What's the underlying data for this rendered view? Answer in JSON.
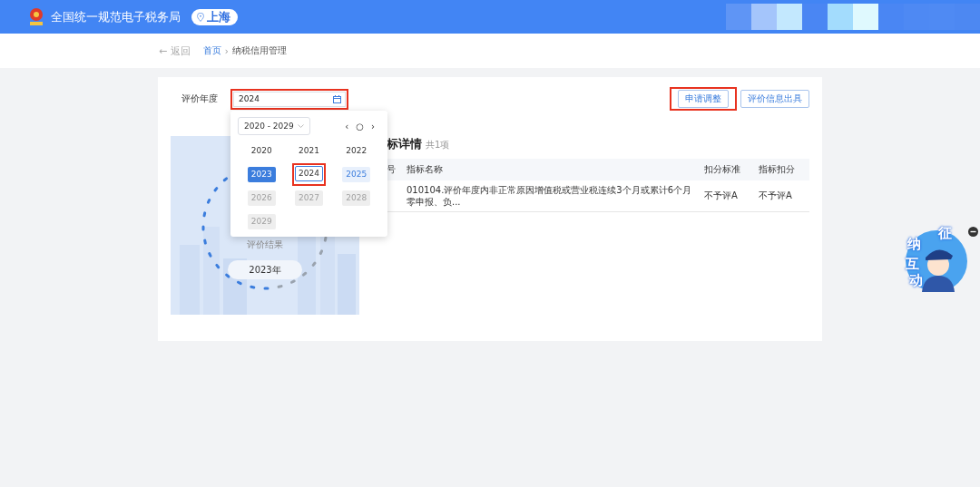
{
  "header": {
    "title": "全国统一规范电子税务局",
    "location": "上海"
  },
  "breadcrumb": {
    "back": "← 返回",
    "items": [
      {
        "label": "首页",
        "link": true
      },
      {
        "label": "纳税信用管理",
        "link": false
      }
    ],
    "separator": "›"
  },
  "filter": {
    "label": "评价年度",
    "value": "2024",
    "highlighted": true
  },
  "actions": [
    {
      "label": "申请调整",
      "highlighted": true
    },
    {
      "label": "评价信息出具",
      "highlighted": false
    }
  ],
  "year_picker": {
    "decade": "2020 - 2029",
    "nav": [
      "‹",
      "○",
      "›"
    ],
    "years": [
      {
        "label": "2020",
        "selected": false,
        "current": false,
        "in_range": false,
        "disabled": false,
        "highlighted": false
      },
      {
        "label": "2021",
        "selected": false,
        "current": false,
        "in_range": false,
        "disabled": false,
        "highlighted": false
      },
      {
        "label": "2022",
        "selected": false,
        "current": false,
        "in_range": false,
        "disabled": false,
        "highlighted": false
      },
      {
        "label": "2023",
        "selected": true,
        "current": false,
        "in_range": false,
        "disabled": false,
        "highlighted": false
      },
      {
        "label": "2024",
        "selected": false,
        "current": true,
        "in_range": false,
        "disabled": false,
        "highlighted": true
      },
      {
        "label": "2025",
        "selected": false,
        "current": false,
        "in_range": true,
        "disabled": false,
        "highlighted": false
      },
      {
        "label": "2026",
        "selected": false,
        "current": false,
        "in_range": false,
        "disabled": true,
        "highlighted": false
      },
      {
        "label": "2027",
        "selected": false,
        "current": false,
        "in_range": false,
        "disabled": true,
        "highlighted": false
      },
      {
        "label": "2028",
        "selected": false,
        "current": false,
        "in_range": false,
        "disabled": true,
        "highlighted": false
      },
      {
        "label": "2029",
        "selected": false,
        "current": false,
        "in_range": false,
        "disabled": true,
        "highlighted": false
      }
    ]
  },
  "result": {
    "label": "评价结果",
    "year": "2023年"
  },
  "details": {
    "title": "标详情",
    "count": "共1项",
    "columns": [
      "号",
      "指标名称",
      "扣分标准",
      "指标扣分"
    ],
    "rows": [
      [
        "",
        "010104.评价年度内非正常原因增值税或营业税连续3个月或累计6个月零申报、负...",
        "不予评A",
        "不予评A"
      ]
    ]
  },
  "widget": {
    "chars": [
      "征",
      "纳",
      "互",
      "动"
    ]
  }
}
